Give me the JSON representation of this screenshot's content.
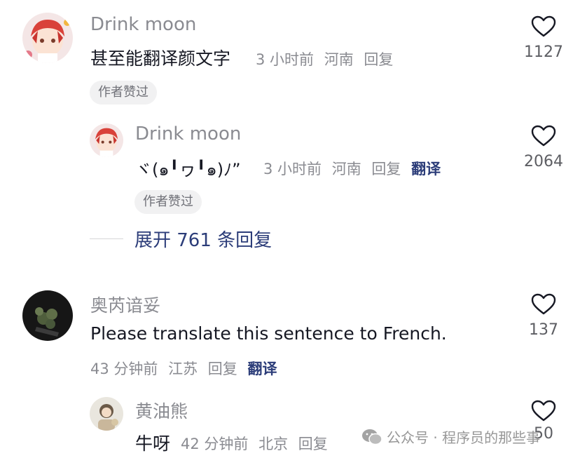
{
  "comments": [
    {
      "username": "Drink moon",
      "text": "甚至能翻译颜文字",
      "time": "3 小时前",
      "location": "河南",
      "reply_label": "回复",
      "badge": "作者赞过",
      "likes": "1127"
    },
    {
      "username": "Drink moon",
      "text": "ヾ(๑╹ヮ╹๑)ﾉ”",
      "time": "3 小时前",
      "location": "河南",
      "reply_label": "回复",
      "translate_label": "翻译",
      "badge": "作者赞过",
      "likes": "2064"
    },
    {
      "username": "奥芮谙妥",
      "text": "Please translate this sentence to French.",
      "time": "43 分钟前",
      "location": "江苏",
      "reply_label": "回复",
      "translate_label": "翻译",
      "likes": "137"
    },
    {
      "username": "黄油熊",
      "text": "牛呀",
      "time": "42 分钟前",
      "location": "北京",
      "reply_label": "回复",
      "likes": "50"
    }
  ],
  "expand_replies": "展开 761 条回复",
  "watermark": "公众号 · 程序员的那些事",
  "icons": {
    "like": "heart-outline-icon",
    "watermark": "wechat-icon"
  },
  "colors": {
    "username": "#8a8b91",
    "link": "#2c3d79",
    "badge_bg": "#f1f1f2"
  }
}
